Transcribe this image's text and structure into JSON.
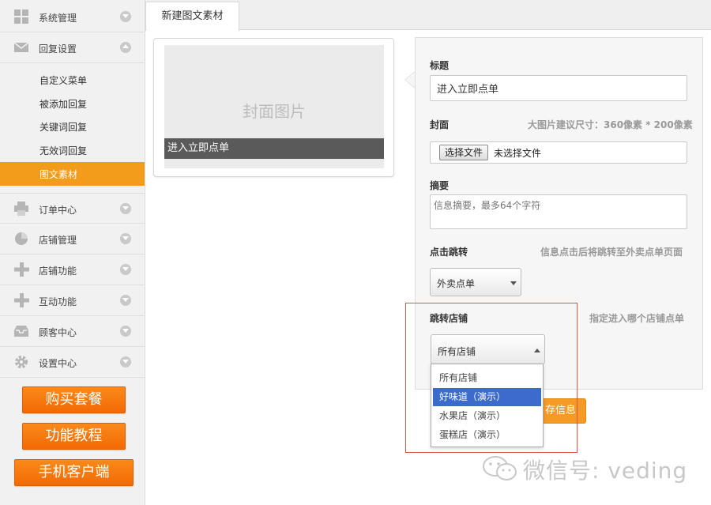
{
  "sidebar": {
    "nav": [
      {
        "label": "系统管理",
        "icon": "grid-icon",
        "expanded": false
      },
      {
        "label": "回复设置",
        "icon": "envelope-icon",
        "expanded": true
      },
      {
        "label": "订单中心",
        "icon": "printer-icon",
        "expanded": false
      },
      {
        "label": "店铺管理",
        "icon": "pie-chart-icon",
        "expanded": false
      },
      {
        "label": "店铺功能",
        "icon": "plus-icon",
        "expanded": false
      },
      {
        "label": "互动功能",
        "icon": "plus-icon",
        "expanded": false
      },
      {
        "label": "顾客中心",
        "icon": "inbox-icon",
        "expanded": false
      },
      {
        "label": "设置中心",
        "icon": "gear-icon",
        "expanded": false
      }
    ],
    "sub_items": [
      {
        "label": "自定义菜单",
        "active": false
      },
      {
        "label": "被添加回复",
        "active": false
      },
      {
        "label": "关键词回复",
        "active": false
      },
      {
        "label": "无效词回复",
        "active": false
      },
      {
        "label": "图文素材",
        "active": true
      }
    ],
    "promo_buttons": [
      "购买套餐",
      "功能教程",
      "手机客户端"
    ]
  },
  "tabs": [
    {
      "label": "新建图文素材",
      "active": true
    }
  ],
  "preview": {
    "cover_placeholder": "封面图片",
    "caption": "进入立即点单"
  },
  "form": {
    "title_label": "标题",
    "title_value": "进入立即点单",
    "cover_label": "封面",
    "cover_hint": "大图片建议尺寸：360像素 * 200像素",
    "file_button": "选择文件",
    "file_status": "未选择文件",
    "summary_label": "摘要",
    "summary_placeholder": "信息摘要，最多64个字符",
    "jump_label": "点击跳转",
    "jump_hint": "信息点击后将跳转至外卖点单页面",
    "jump_value": "外卖点单",
    "store_label": "跳转店铺",
    "store_hint": "指定进入哪个店铺点单",
    "store_value": "所有店铺",
    "store_options": [
      "所有店铺",
      "好味道（演示）",
      "水果店（演示）",
      "蛋糕店（演示）"
    ],
    "store_selected_index": 1,
    "save_button": "存信息"
  },
  "watermark": {
    "text": "微信号: veding",
    "icon": "wechat-icon"
  },
  "colors": {
    "accent": "#f39c1c",
    "promo": "#f26a04",
    "select_highlight": "#3a6bcd",
    "callout_border": "#d9534f"
  }
}
